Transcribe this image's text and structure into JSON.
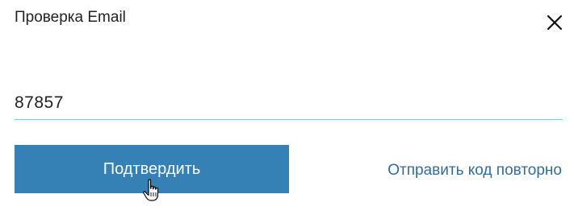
{
  "dialog": {
    "title": "Проверка Email",
    "close_icon": "close-icon"
  },
  "code_input": {
    "value": "87857",
    "underline_color": "#8cc4d8"
  },
  "actions": {
    "confirm_label": "Подтвердить",
    "resend_label": "Отправить код повторно"
  },
  "colors": {
    "primary_button": "#3580b5",
    "link": "#2f6d9f"
  },
  "cursor": {
    "icon": "hand-pointer-icon"
  }
}
